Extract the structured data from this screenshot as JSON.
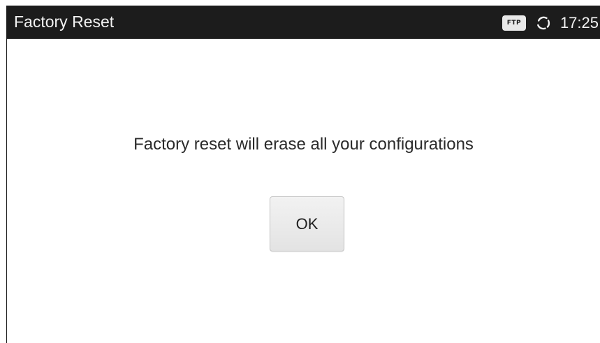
{
  "title_bar": {
    "title": "Factory Reset",
    "status": {
      "ftp_badge": "FTP",
      "sync_icon": "sync-icon",
      "clock": "17:25"
    }
  },
  "dialog": {
    "message": "Factory reset will erase all your configurations",
    "ok_label": "OK"
  },
  "colors": {
    "title_bar_background": "#1c1c1c",
    "title_text": "#f2f2f2",
    "content_background": "#ffffff",
    "message_text": "#2a2a2a",
    "button_background": "#e8e8e8"
  }
}
